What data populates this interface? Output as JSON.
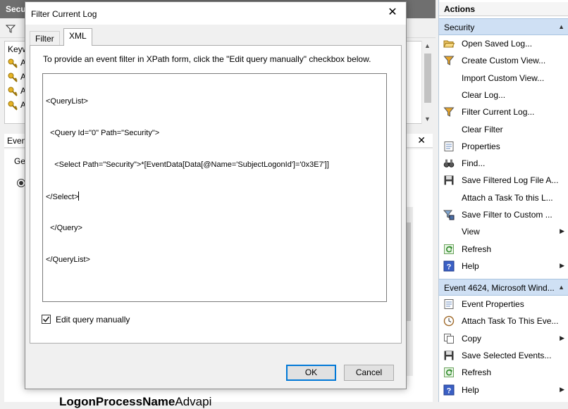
{
  "background": {
    "title_fragment": "Secu",
    "list_header_fragment": "Keyw",
    "row_fragments": [
      "A",
      "A",
      "A",
      "A"
    ],
    "detail_header_fragment": "Even",
    "detail_tab_fragment": "Ge",
    "bottom_text_bold": "LogonProcessName",
    "bottom_text_plain": "Advapi"
  },
  "actions": {
    "title": "Actions",
    "sections": [
      {
        "header": "Security",
        "items": [
          {
            "label": "Open Saved Log...",
            "icon": "folder-open-icon"
          },
          {
            "label": "Create Custom View...",
            "icon": "filter-funnel-icon"
          },
          {
            "label": "Import Custom View...",
            "icon": "none"
          },
          {
            "label": "Clear Log...",
            "icon": "none"
          },
          {
            "label": "Filter Current Log...",
            "icon": "filter-funnel-icon"
          },
          {
            "label": "Clear Filter",
            "icon": "none"
          },
          {
            "label": "Properties",
            "icon": "properties-icon"
          },
          {
            "label": "Find...",
            "icon": "binoculars-icon"
          },
          {
            "label": "Save Filtered Log File A...",
            "icon": "floppy-disk-icon"
          },
          {
            "label": "Attach a Task To this L...",
            "icon": "none"
          },
          {
            "label": "Save Filter to Custom ...",
            "icon": "filter-save-icon"
          },
          {
            "label": "View",
            "icon": "none",
            "submenu": true
          },
          {
            "label": "Refresh",
            "icon": "refresh-icon"
          },
          {
            "label": "Help",
            "icon": "help-icon",
            "submenu": true
          }
        ]
      },
      {
        "header": "Event 4624, Microsoft Wind...",
        "items": [
          {
            "label": "Event Properties",
            "icon": "properties-icon"
          },
          {
            "label": "Attach Task To This Eve...",
            "icon": "task-clock-icon"
          },
          {
            "label": "Copy",
            "icon": "copy-icon",
            "submenu": true
          },
          {
            "label": "Save Selected Events...",
            "icon": "floppy-disk-icon"
          },
          {
            "label": "Refresh",
            "icon": "refresh-icon"
          },
          {
            "label": "Help",
            "icon": "help-icon",
            "submenu": true
          }
        ]
      }
    ]
  },
  "dialog": {
    "title": "Filter Current Log",
    "close_glyph": "✕",
    "tabs": [
      {
        "label": "Filter",
        "active": false
      },
      {
        "label": "XML",
        "active": true
      }
    ],
    "instruction": "To provide an event filter in XPath form, click the \"Edit query manually\" checkbox below.",
    "xml_lines": [
      "<QueryList>",
      "  <Query Id=\"0\" Path=\"Security\">",
      "    <Select Path=\"Security\">*[EventData[Data[@Name='SubjectLogonId']='0x3E7']]",
      "</Select>",
      "  </Query>",
      "</QueryList>"
    ],
    "edit_manually_label": "Edit query manually",
    "edit_manually_checked": true,
    "ok_label": "OK",
    "cancel_label": "Cancel"
  }
}
